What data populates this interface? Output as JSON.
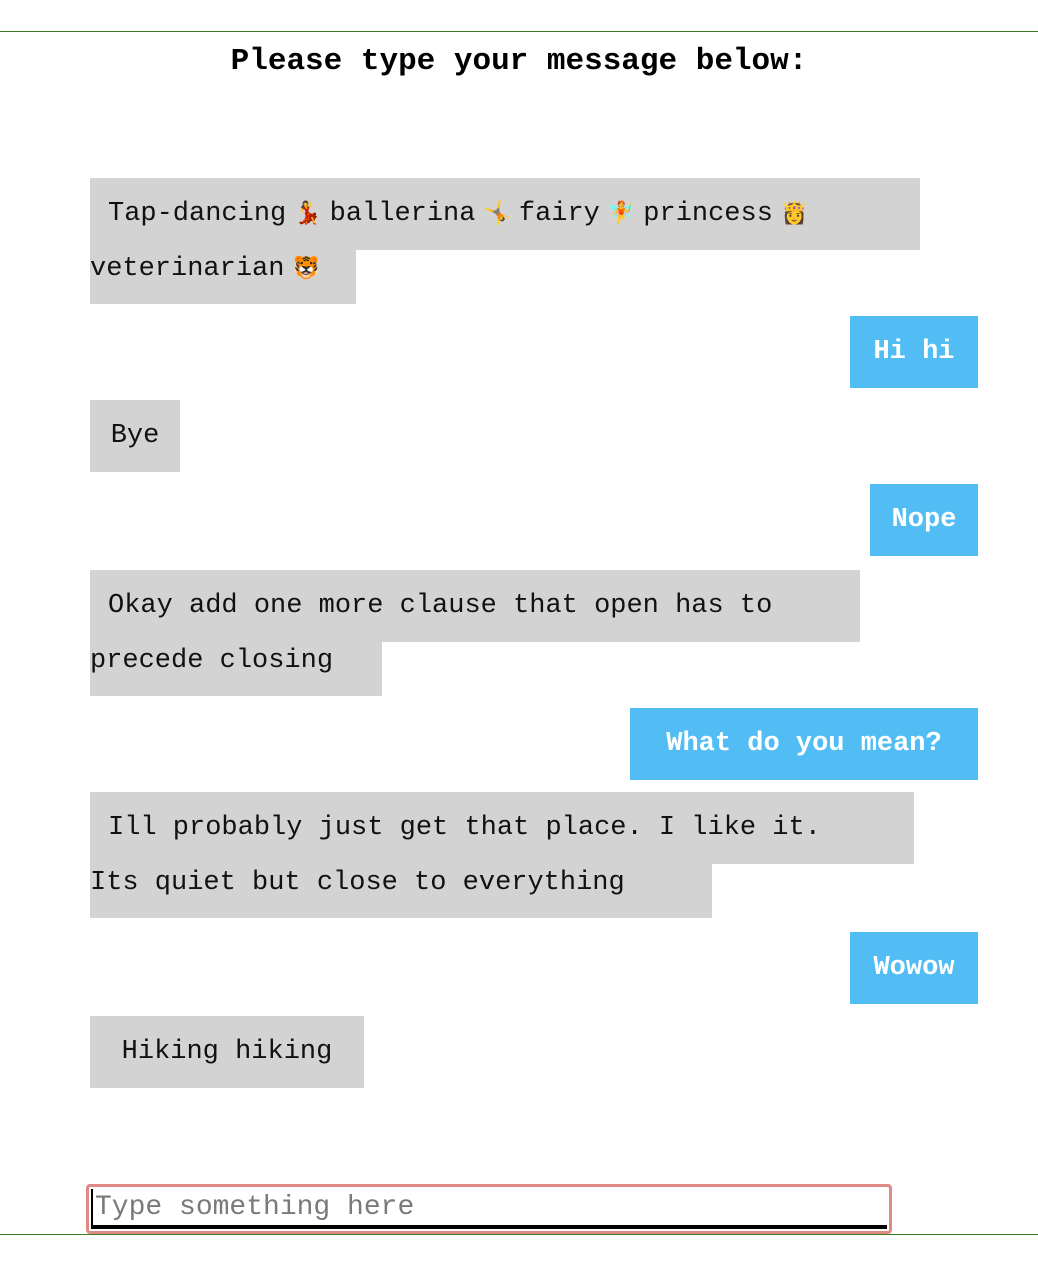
{
  "header": {
    "title": "Please type your message below:"
  },
  "messages": [
    {
      "sender": "other",
      "line1": "Tap-dancing",
      "words": [
        "ballerina",
        "fairy",
        "princess"
      ],
      "line2": "veterinarian",
      "icons": [
        "dancer-icon",
        "gymnast-icon",
        "fairy-icon",
        "princess-icon",
        "tiger-face-icon"
      ]
    },
    {
      "sender": "me",
      "text": "Hi hi"
    },
    {
      "sender": "other",
      "text": "Bye"
    },
    {
      "sender": "me",
      "text": "Nope"
    },
    {
      "sender": "other",
      "line1": "Okay add one more clause that open has to",
      "line2": "precede closing"
    },
    {
      "sender": "me",
      "text": "What do you mean?"
    },
    {
      "sender": "other",
      "line1": "Ill probably just get that place. I like it.",
      "line2": "Its quiet but close to everything"
    },
    {
      "sender": "me",
      "text": "Wowow"
    },
    {
      "sender": "other",
      "text": "Hiking hiking"
    }
  ],
  "composer": {
    "placeholder": "Type something here",
    "value": ""
  },
  "colors": {
    "incoming_bubble": "#d3d3d3",
    "outgoing_bubble": "#51bdf4",
    "frame_border": "#3e7a1e",
    "input_focus_ring": "#e08a86"
  }
}
